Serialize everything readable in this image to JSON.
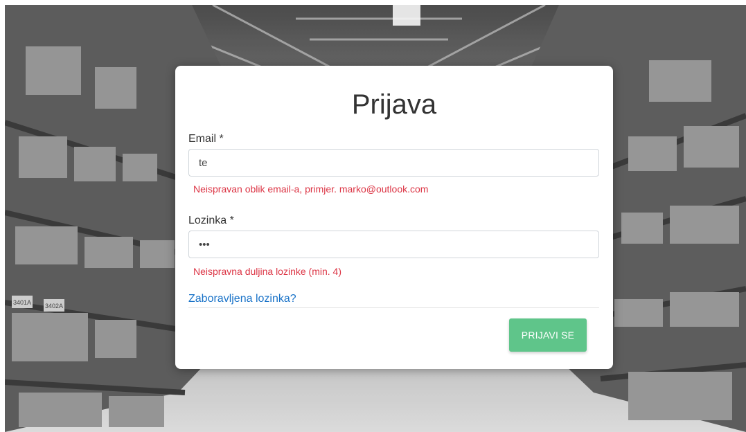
{
  "form": {
    "title": "Prijava",
    "email_label": "Email *",
    "email_value": "te",
    "email_error": "Neispravan oblik email-a, primjer. marko@outlook.com",
    "password_label": "Lozinka *",
    "password_value": "abc",
    "password_error": "Neispravna duljina lozinke (min. 4)",
    "forgot_link": "Zaboravljena lozinka?",
    "submit_label": "PRIJAVI SE"
  },
  "background": {
    "rack_labels": [
      "3401A",
      "3402A"
    ]
  },
  "colors": {
    "error": "#dc3545",
    "link": "#1a73c8",
    "submit": "#5fc58a"
  }
}
